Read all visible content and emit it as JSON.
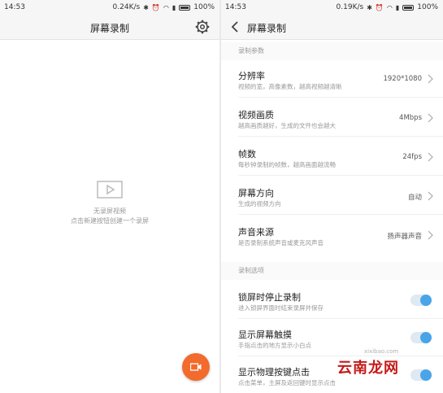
{
  "left": {
    "status": {
      "time": "14:53",
      "speed": "0.24K/s",
      "battery": "100%"
    },
    "title": "屏幕录制",
    "empty": {
      "line1": "无录屏视频",
      "line2": "点击新建按钮创建一个录屏"
    }
  },
  "right": {
    "status": {
      "time": "14:53",
      "speed": "0.19K/s",
      "battery": "100%"
    },
    "title": "屏幕录制",
    "section1": "录制参数",
    "rows": [
      {
        "title": "分辨率",
        "subtitle": "视频的宽，高像素数，越高视频越清晰",
        "value": "1920*1080"
      },
      {
        "title": "视频画质",
        "subtitle": "越高画质越好，生成的文件也会越大",
        "value": "4Mbps"
      },
      {
        "title": "帧数",
        "subtitle": "每秒钟录制的帧数，越高画面越流畅",
        "value": "24fps"
      },
      {
        "title": "屏幕方向",
        "subtitle": "生成的视频方向",
        "value": "自动"
      },
      {
        "title": "声音来源",
        "subtitle": "是否录制系统声音或麦克风声音",
        "value": "扬声器声音"
      }
    ],
    "section2": "录制选项",
    "toggles": [
      {
        "title": "锁屏时停止录制",
        "subtitle": "进入锁屏界面时结束录屏并保存",
        "on": true
      },
      {
        "title": "显示屏幕触摸",
        "subtitle": "手指点击的地方显示小白点",
        "on": true
      },
      {
        "title": "显示物理按键点击",
        "subtitle": "点击菜单，主屏及返回键时显示点击",
        "on": true
      }
    ]
  },
  "watermark": {
    "text": "云南龙网",
    "url": "xixibao.com"
  },
  "colors": {
    "accent": "#f36a2d",
    "toggle": "#4aa5e8"
  }
}
